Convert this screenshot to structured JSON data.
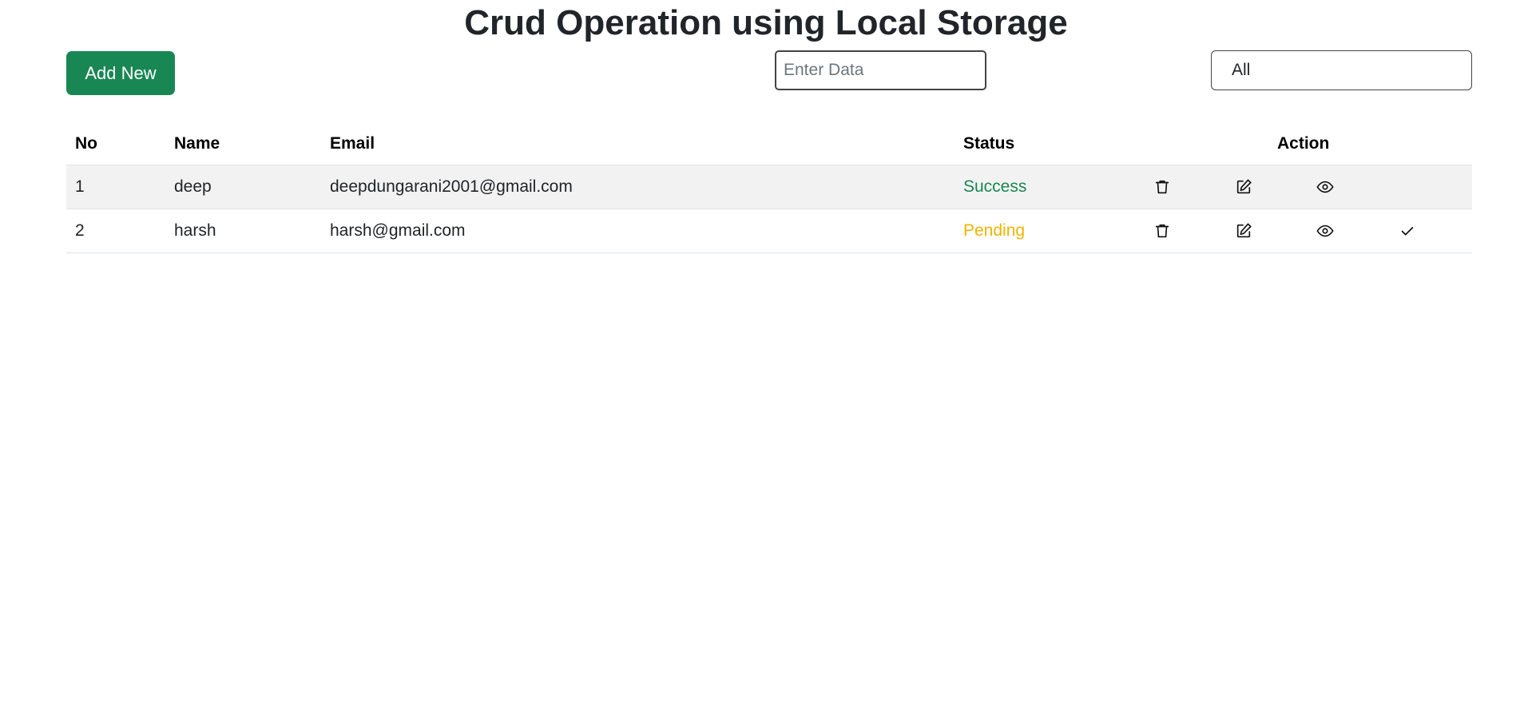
{
  "page": {
    "title": "Crud Operation using Local Storage"
  },
  "toolbar": {
    "add_label": "Add New",
    "search": {
      "placeholder": "Enter Data",
      "value": ""
    },
    "filter": {
      "selected": "All"
    }
  },
  "table": {
    "headers": {
      "no": "No",
      "name": "Name",
      "email": "Email",
      "status": "Status",
      "action": "Action"
    },
    "rows": [
      {
        "no": "1",
        "name": "deep",
        "email": "deepdungarani2001@gmail.com",
        "status": "Success",
        "status_color": "#198754",
        "actions": [
          "trash-icon",
          "edit-icon",
          "eye-icon"
        ]
      },
      {
        "no": "2",
        "name": "harsh",
        "email": "harsh@gmail.com",
        "status": "Pending",
        "status_color": "#f0b400",
        "actions": [
          "trash-icon",
          "edit-icon",
          "eye-icon",
          "check-icon"
        ]
      }
    ]
  },
  "colors": {
    "accent": "#198754",
    "pending": "#f0b400",
    "row_stripe": "#f2f2f2"
  }
}
